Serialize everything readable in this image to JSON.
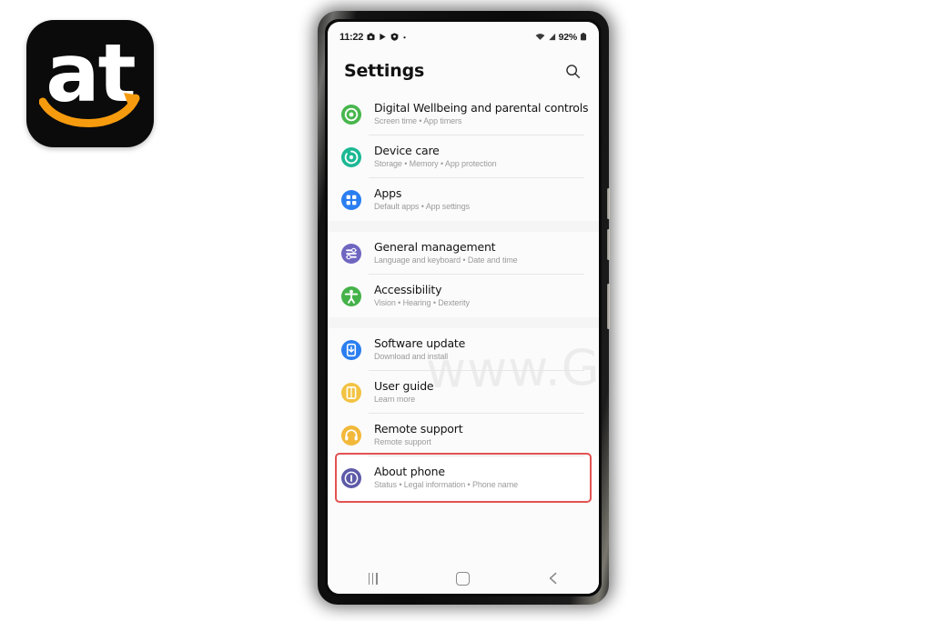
{
  "brand": {
    "logo_text": "at",
    "logo_bg": "#0b0b0b",
    "smile_color": "#f79b0e",
    "name": "at-logo"
  },
  "phone": {
    "status_bar": {
      "time": "11:22",
      "left_icons": [
        "camera-icon",
        "play-icon",
        "shield-icon",
        "dot-icon"
      ],
      "right_icons": [
        "wifi-icon",
        "signal-icon",
        "battery-icon"
      ],
      "battery_percent": "92%"
    },
    "header": {
      "title": "Settings",
      "search_icon": "search-icon"
    },
    "watermark": "www.Gal",
    "groups": [
      {
        "items": [
          {
            "title": "Digital Wellbeing and parental controls",
            "subtitle": "Screen time  •  App timers",
            "icon": "wellbeing-icon",
            "color": "#47b64c",
            "highlighted": false
          },
          {
            "title": "Device care",
            "subtitle": "Storage  •  Memory  •  App protection",
            "icon": "device-care-icon",
            "color": "#1bb894",
            "highlighted": false
          },
          {
            "title": "Apps",
            "subtitle": "Default apps  •  App settings",
            "icon": "apps-icon",
            "color": "#2a7ef0",
            "highlighted": false
          }
        ]
      },
      {
        "items": [
          {
            "title": "General management",
            "subtitle": "Language and keyboard  •  Date and time",
            "icon": "general-management-icon",
            "color": "#6f66c0",
            "highlighted": false
          },
          {
            "title": "Accessibility",
            "subtitle": "Vision  •  Hearing  •  Dexterity",
            "icon": "accessibility-icon",
            "color": "#45b249",
            "highlighted": false
          }
        ]
      },
      {
        "items": [
          {
            "title": "Software update",
            "subtitle": "Download and install",
            "icon": "software-update-icon",
            "color": "#2a7ef0",
            "highlighted": false
          },
          {
            "title": "User guide",
            "subtitle": "Learn more",
            "icon": "user-guide-icon",
            "color": "#f2c342",
            "highlighted": false
          },
          {
            "title": "Remote support",
            "subtitle": "Remote support",
            "icon": "remote-support-icon",
            "color": "#f2b83a",
            "highlighted": false
          },
          {
            "title": "About phone",
            "subtitle": "Status  •  Legal information  •  Phone name",
            "icon": "about-phone-icon",
            "color": "#5d5aa8",
            "highlighted": true
          }
        ]
      }
    ],
    "highlight_color": "#e35252",
    "nav_bar": {
      "recents_label": "recents-icon",
      "home_label": "home-icon",
      "back_label": "back-icon"
    }
  }
}
